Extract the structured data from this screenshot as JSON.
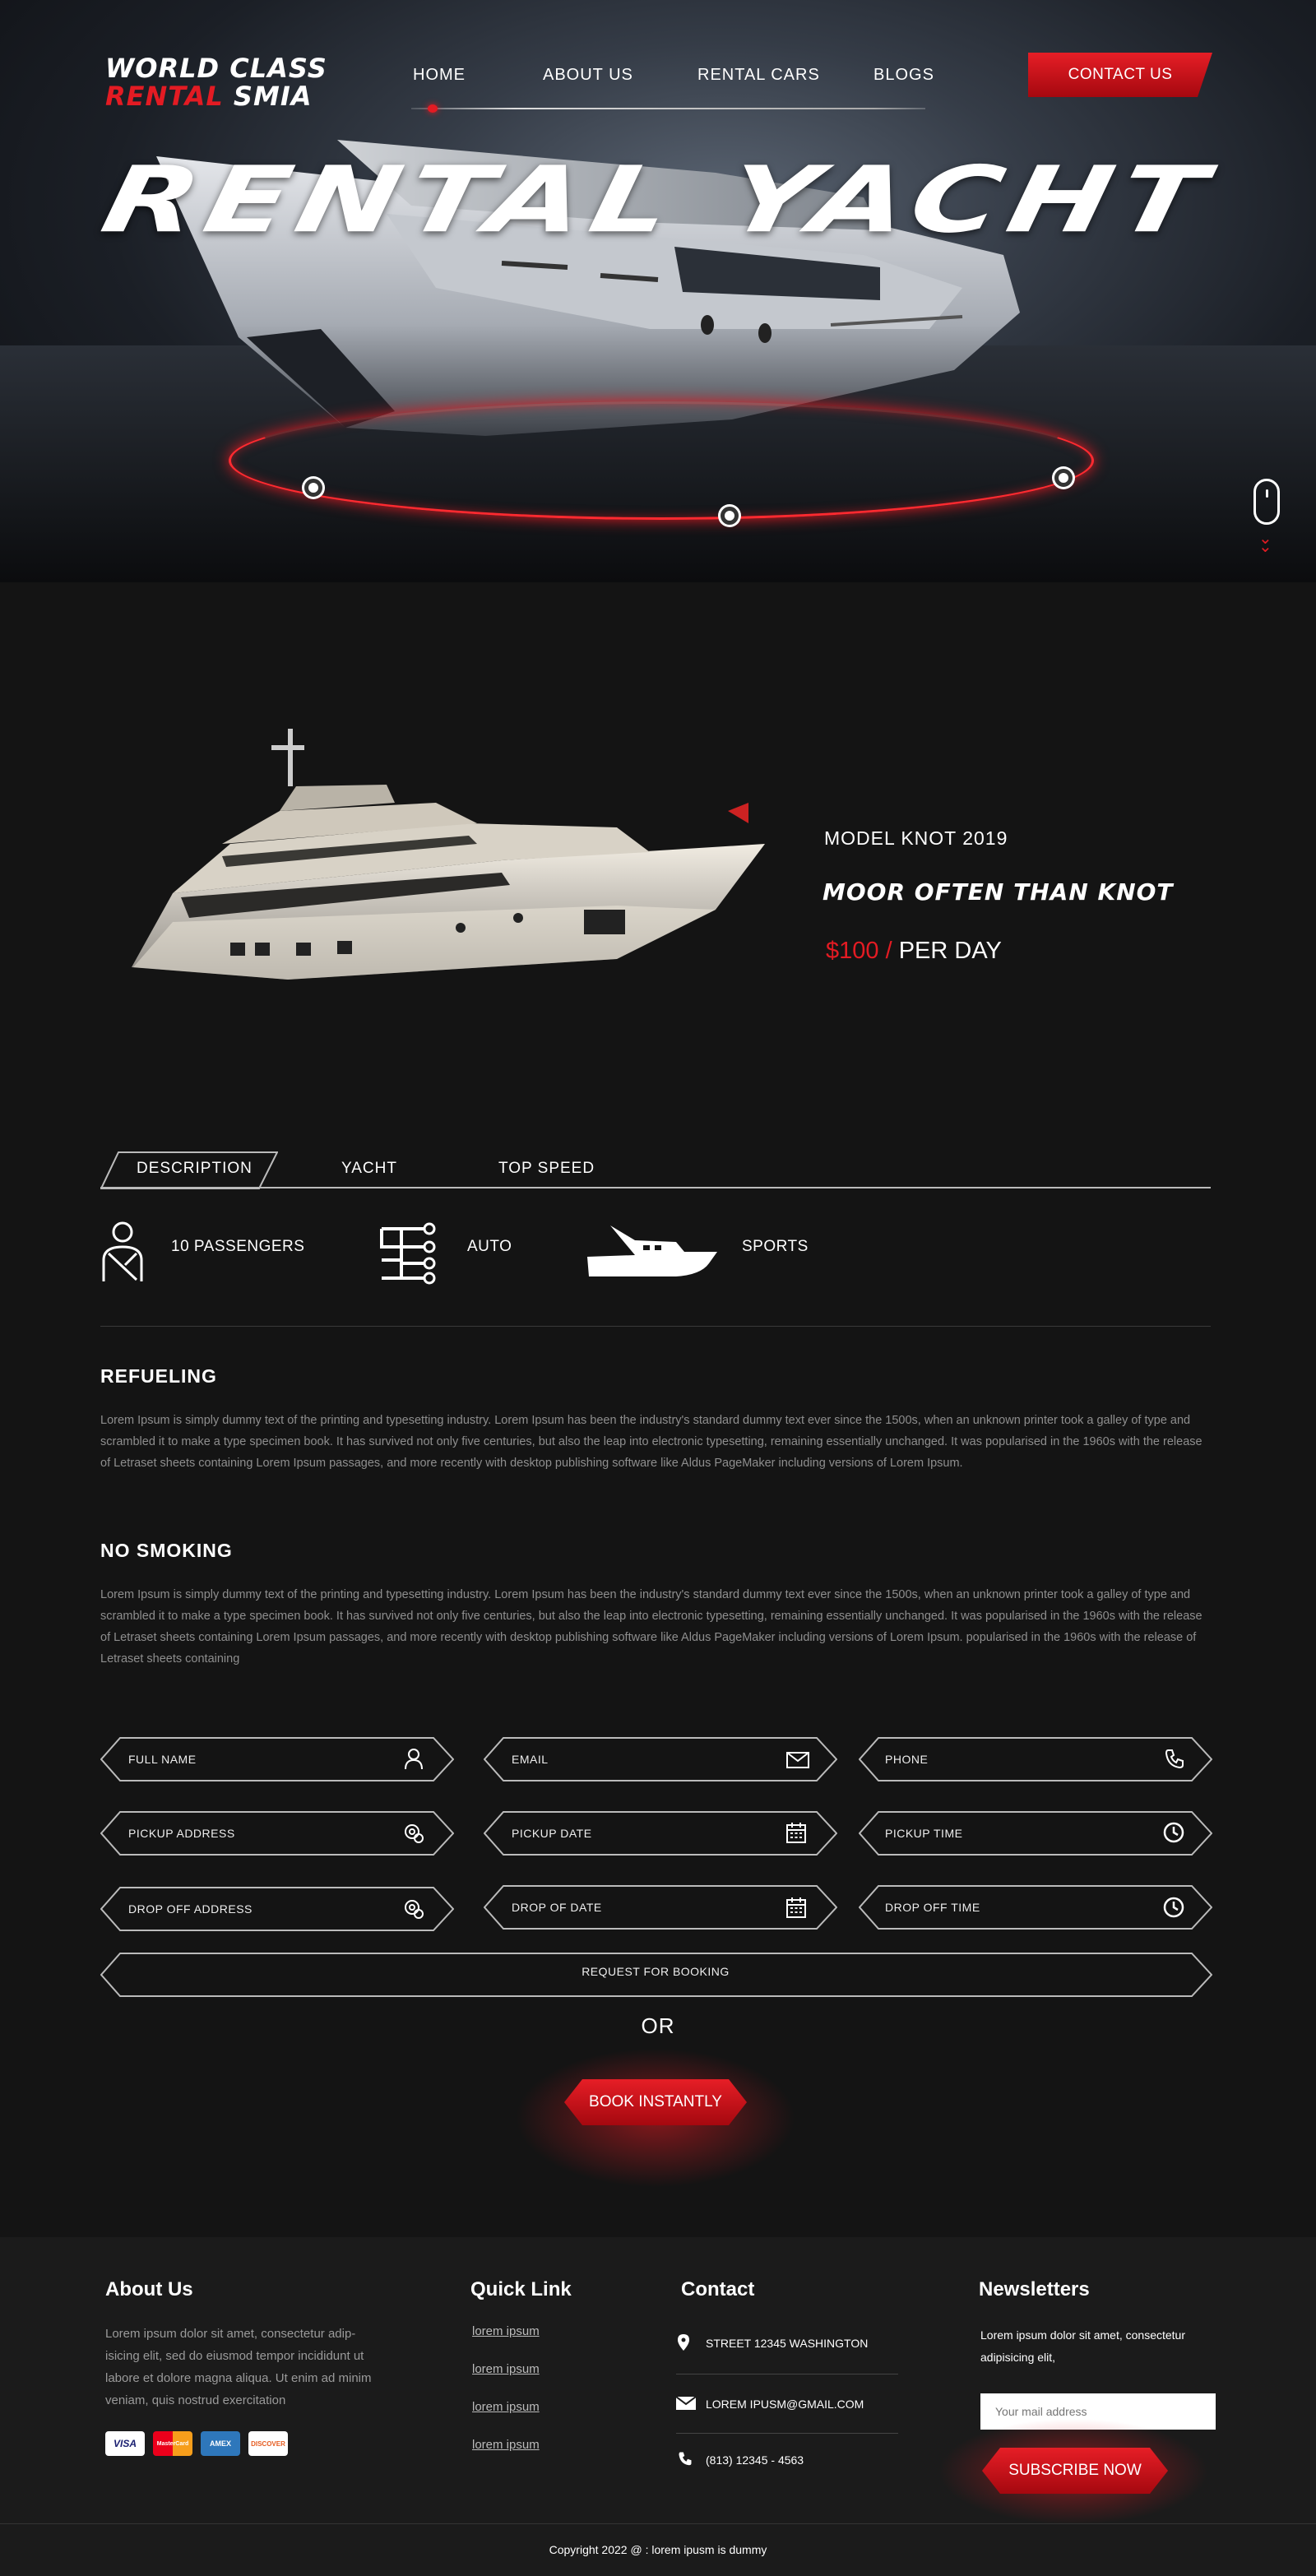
{
  "brand": {
    "line1": "WORLD CLASS",
    "line2a": "RENTAL",
    "line2b": "SMIA"
  },
  "nav": {
    "items": [
      "HOME",
      "ABOUT US",
      "RENTAL CARS",
      "BLOGS"
    ],
    "contact": "CONTACT US"
  },
  "hero": {
    "title": "RENTAL YACHT"
  },
  "product": {
    "model": "MODEL KNOT 2019",
    "tagline": "MOOR OFTEN THAN KNOT",
    "price": "$100 /",
    "per": "PER DAY"
  },
  "tabs": [
    "DESCRIPTION",
    "YACHT",
    "TOP SPEED"
  ],
  "features": [
    {
      "icon": "passenger-icon",
      "label": "10 PASSENGERS"
    },
    {
      "icon": "transmission-icon",
      "label": "AUTO"
    },
    {
      "icon": "speedboat-icon",
      "label": "SPORTS"
    }
  ],
  "sections": [
    {
      "title": "REFUELING",
      "text": "Lorem Ipsum is simply dummy text of the printing and typesetting industry. Lorem Ipsum has been the industry's standard dummy text ever since the 1500s, when an unknown printer took a galley of type and scrambled it to make a type specimen book. It has survived not only five centuries, but also the leap into electronic typesetting, remaining essentially unchanged. It was popularised in the 1960s with the release of Letraset sheets containing Lorem Ipsum passages, and more recently with desktop publishing software like Aldus PageMaker including versions of Lorem Ipsum."
    },
    {
      "title": "NO SMOKING",
      "text": "Lorem Ipsum is simply dummy text of the printing and typesetting industry. Lorem Ipsum has been the industry's standard dummy text ever since the 1500s, when an unknown printer took a galley of type and scrambled it to make a type specimen book. It has survived not only five centuries, but also the leap into electronic typesetting, remaining essentially unchanged. It was popularised in the 1960s with the release of Letraset sheets containing Lorem Ipsum passages, and more recently with desktop publishing software like Aldus PageMaker including versions of Lorem Ipsum. popularised in the 1960s with the release of Letraset sheets containing"
    }
  ],
  "form": {
    "fields": [
      {
        "label": "FULL NAME",
        "icon": "user-icon"
      },
      {
        "label": "EMAIL",
        "icon": "envelope-icon"
      },
      {
        "label": "PHONE",
        "icon": "phone-icon"
      },
      {
        "label": "PICKUP ADDRESS",
        "icon": "location-icon"
      },
      {
        "label": "PICKUP DATE",
        "icon": "calendar-icon"
      },
      {
        "label": "PICKUP TIME",
        "icon": "clock-icon"
      },
      {
        "label": "DROP OFF ADDRESS",
        "icon": "location-icon"
      },
      {
        "label": "DROP OF DATE",
        "icon": "calendar-icon"
      },
      {
        "label": "DROP OFF TIME",
        "icon": "clock-icon"
      }
    ],
    "request": "REQUEST FOR BOOKING",
    "or": "OR",
    "book": "BOOK INSTANTLY"
  },
  "footer": {
    "about": {
      "title": "About Us",
      "text": "Lorem ipsum dolor sit amet, consectetur adip-isicing elit, sed do eiusmod tempor incididunt ut labore et dolore magna aliqua. Ut enim ad minim veniam, quis nostrud exercitation",
      "cards": [
        "VISA",
        "MasterCard",
        "AMEX",
        "DISCOVER"
      ]
    },
    "quick": {
      "title": "Quick Link",
      "links": [
        "lorem ipsum",
        "lorem ipsum",
        "lorem ipsum",
        "lorem ipsum"
      ]
    },
    "contact": {
      "title": "Contact",
      "address": "STREET 12345 WASHINGTON",
      "email": "LOREM IPUSM@GMAIL.COM",
      "phone": "(813) 12345 - 4563"
    },
    "news": {
      "title": "Newsletters",
      "text": "Lorem ipsum dolor sit amet, consectetur adipisicing elit,",
      "placeholder": "Your mail address",
      "button": "SUBSCRIBE NOW"
    },
    "copyright": "Copyright 2022  @ : lorem ipusm is dummy"
  },
  "colors": {
    "accent": "#e31b23",
    "background": "#141414",
    "footer": "#1b1b1b"
  }
}
